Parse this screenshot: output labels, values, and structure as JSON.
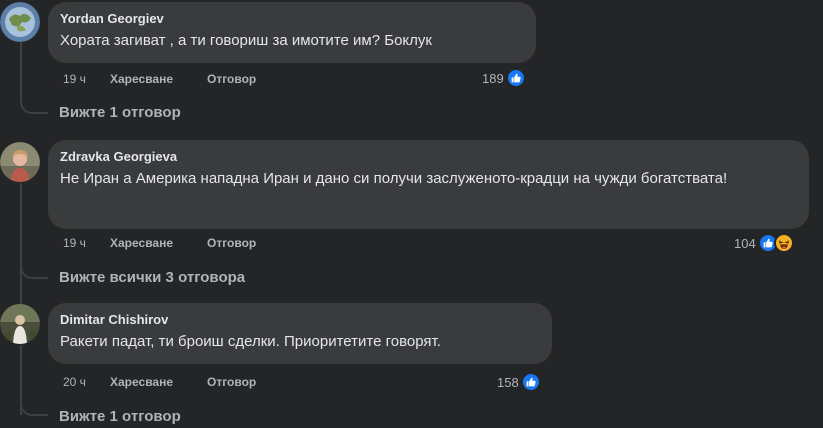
{
  "comments": [
    {
      "author": "Yordan Georgiev",
      "text": "Хората загиват , а ти говориш за имотите им? Боклук",
      "time": "19 ч",
      "like_label": "Харесване",
      "reply_label": "Отговор",
      "reaction_count": "189",
      "reactions": [
        "like-icon"
      ],
      "view_replies": "Вижте 1 отговор"
    },
    {
      "author": "Zdravka Georgieva",
      "text": "Не Иран а Америка нападна Иран и дано си получи заслуженото-крадци на чужди богатствата!",
      "time": "19 ч",
      "like_label": "Харесване",
      "reply_label": "Отговор",
      "reaction_count": "104",
      "reactions": [
        "like-icon",
        "haha-icon"
      ],
      "view_replies": "Вижте всички 3 отговора"
    },
    {
      "author": "Dimitar Chishirov",
      "text": "Ракети падат, ти броиш сделки. Приоритетите говорят.",
      "time": "20 ч",
      "like_label": "Харесване",
      "reply_label": "Отговор",
      "reaction_count": "158",
      "reactions": [
        "like-icon"
      ],
      "view_replies": "Вижте 1 отговор"
    }
  ],
  "colors": {
    "background": "#242526",
    "bubble": "#3a3b3c",
    "text": "#e4e6eb",
    "secondary": "#b0b3b8",
    "like_blue": "#1877f2",
    "haha_yellow": "#f7b125"
  }
}
